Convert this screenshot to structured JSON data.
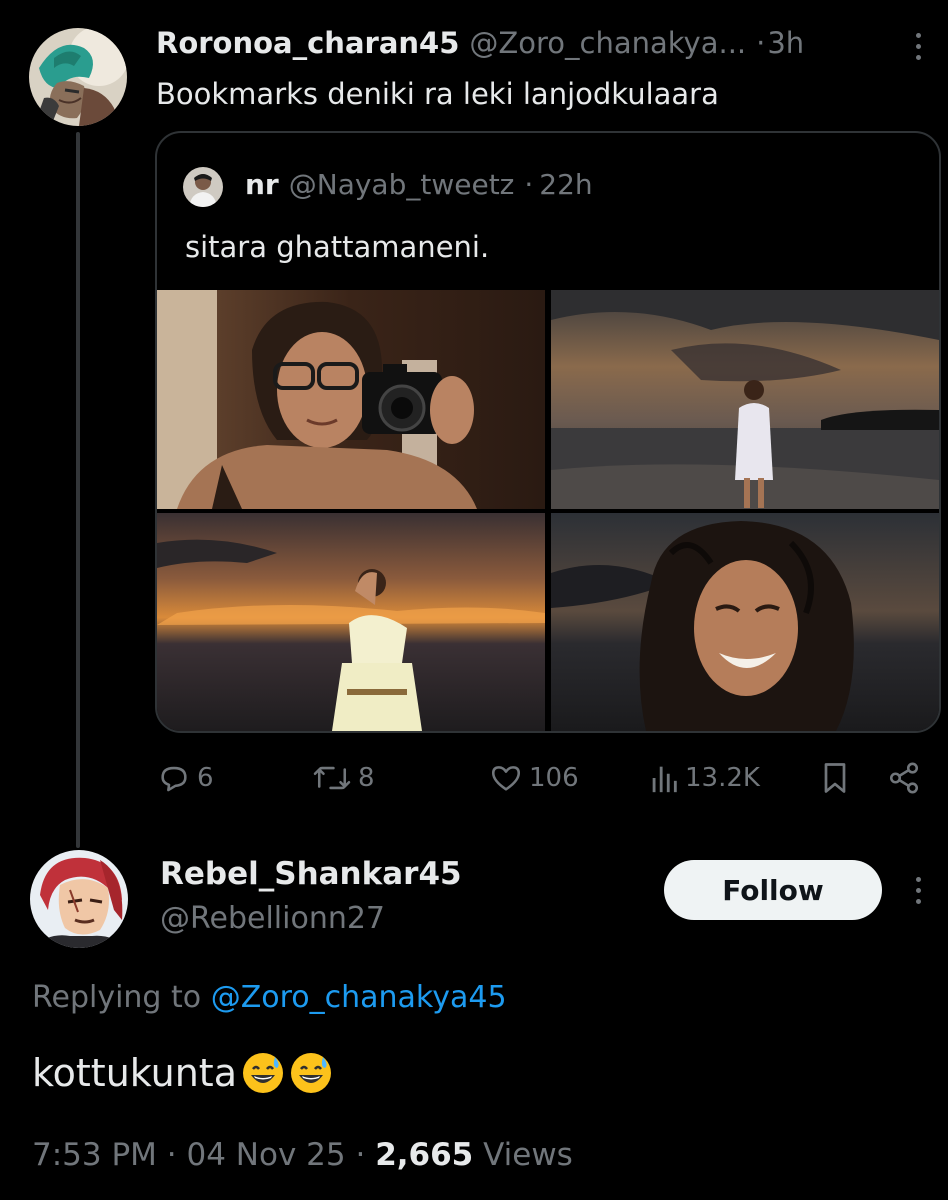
{
  "parent_tweet": {
    "display_name": "Roronoa_charan45",
    "handle": "@Zoro_chanakya...",
    "separator": "·",
    "time": "3h",
    "text": "Bookmarks deniki ra leki lanjodkulaara",
    "avatar_icon": "zoro-avatar"
  },
  "quoted_tweet": {
    "display_name": "nr",
    "handle": "@Nayab_tweetz",
    "separator": "·",
    "time": "22h",
    "text": "sitara ghattamaneni.",
    "photos": [
      "mirror-selfie-photo",
      "beach-sunset-photo",
      "sunset-white-dress-photo",
      "smiling-curly-hair-photo"
    ]
  },
  "actions": {
    "replies": "6",
    "retweets": "8",
    "likes": "106",
    "views": "13.2K"
  },
  "reply_tweet": {
    "display_name": "Rebel_Shankar45",
    "handle": "@Rebellionn27",
    "follow_label": "Follow",
    "replying_prefix": "Replying to",
    "replying_to": "@Zoro_chanakya45",
    "text": "kottukunta",
    "emojis": [
      "grinning-sweat-emoji",
      "grinning-sweat-emoji"
    ],
    "time": "7:53 PM",
    "separator": "·",
    "date": "04 Nov 25",
    "views_count": "2,665",
    "views_label": "Views"
  },
  "colors": {
    "background": "#000000",
    "text": "#e7e9ea",
    "muted": "#71767b",
    "link": "#1d9bf0",
    "border": "#2f3336",
    "follow_bg": "#eff3f4"
  }
}
